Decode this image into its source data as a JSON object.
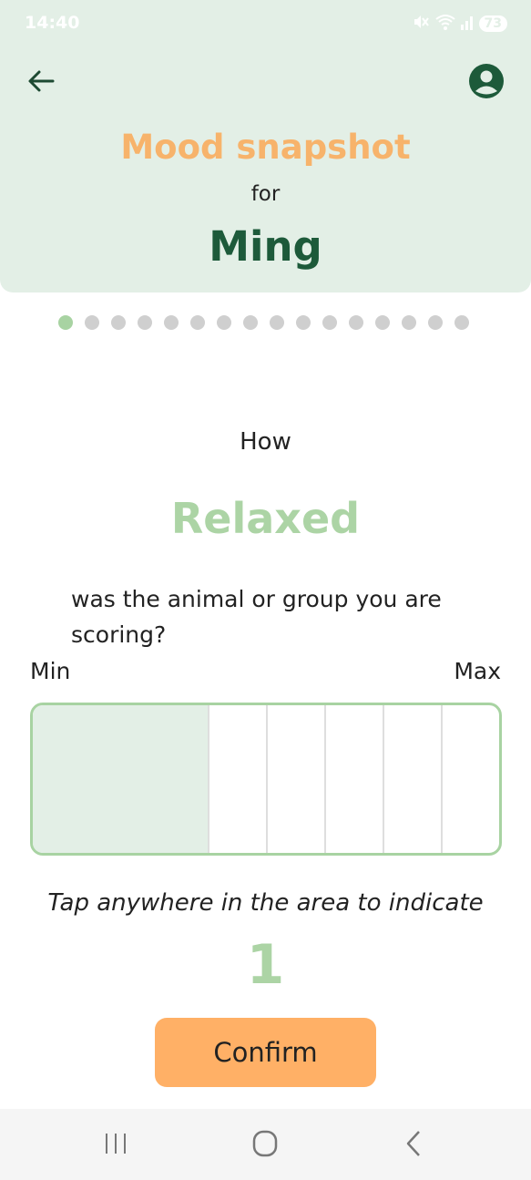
{
  "status_bar": {
    "time": "14:40",
    "battery": "73",
    "icons": [
      "mute-icon",
      "wifi-icon",
      "signal-icon",
      "battery-icon"
    ]
  },
  "header": {
    "back_icon": "arrow-left-icon",
    "profile_icon": "account-circle-icon",
    "title": "Mood snapshot",
    "for_label": "for",
    "subject_name": "Ming"
  },
  "progress": {
    "total_steps": 16,
    "current_step": 1
  },
  "question": {
    "prefix": "How",
    "mood": "Relaxed",
    "suffix": "was the animal or group you are scoring?"
  },
  "scale": {
    "min_label": "Min",
    "max_label": "Max",
    "fill_fraction": 0.375,
    "divisions": 8
  },
  "instruction": "Tap anywhere in the area to indicate",
  "score_value": "1",
  "confirm_label": "Confirm",
  "colors": {
    "header_bg": "#e3efe6",
    "title": "#f7b36b",
    "name": "#1d5a3a",
    "accent_green": "#a8d3a2",
    "button": "#ffb066"
  },
  "nav_bar": {
    "items": [
      "recent-apps-icon",
      "home-icon",
      "back-icon"
    ]
  }
}
